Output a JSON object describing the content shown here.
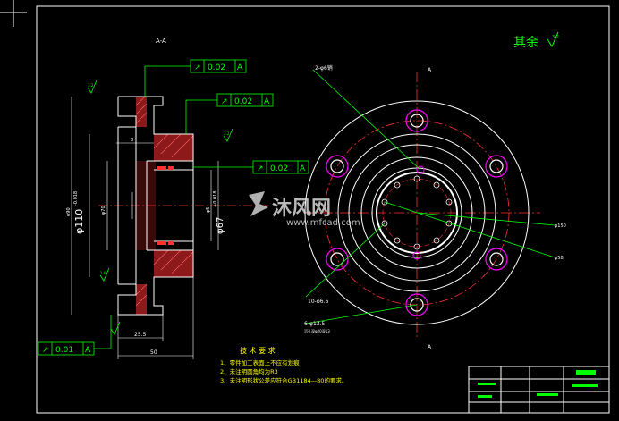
{
  "section_label": "A-A",
  "roughness_remaining": "其余",
  "roughness_value": "3.2",
  "tolerance_frames": [
    {
      "symbol": "↗",
      "value": "0.02",
      "datum": "A"
    },
    {
      "symbol": "↗",
      "value": "0.02",
      "datum": "A"
    },
    {
      "symbol": "↗",
      "value": "0.02",
      "datum": "A"
    },
    {
      "symbol": "↗",
      "value": "0.01",
      "datum": "A"
    }
  ],
  "dimensions": {
    "d110": "φ110",
    "d110_tol": "-0.018",
    "d90": "φ90",
    "d70": "φ70",
    "d67": "φ67",
    "d67_tol": "+0.018",
    "d55": "φ5",
    "w255": "25.5",
    "w50": "50",
    "d8": "8",
    "d150": "φ150",
    "d58": "φ58",
    "r1": "3.2",
    "r2": "1.6",
    "r3": "3.2"
  },
  "callouts": {
    "holes_2": "2-φ6销",
    "holes_10": "10-φ6.6",
    "holes_6": "6-φ13.5",
    "holes_6_sub": "沉孔深φ20深13",
    "section_marker": "A"
  },
  "tech_requirements": {
    "title": "技 术 要 求",
    "items": [
      "1、零件加工表面上不应有划痕",
      "2、未注明圆角均为R3",
      "3、未注明形状公差应符合GB1184—80的要求。"
    ]
  },
  "watermark": {
    "brand": "沐风网",
    "url": "www.mfcad.com"
  }
}
